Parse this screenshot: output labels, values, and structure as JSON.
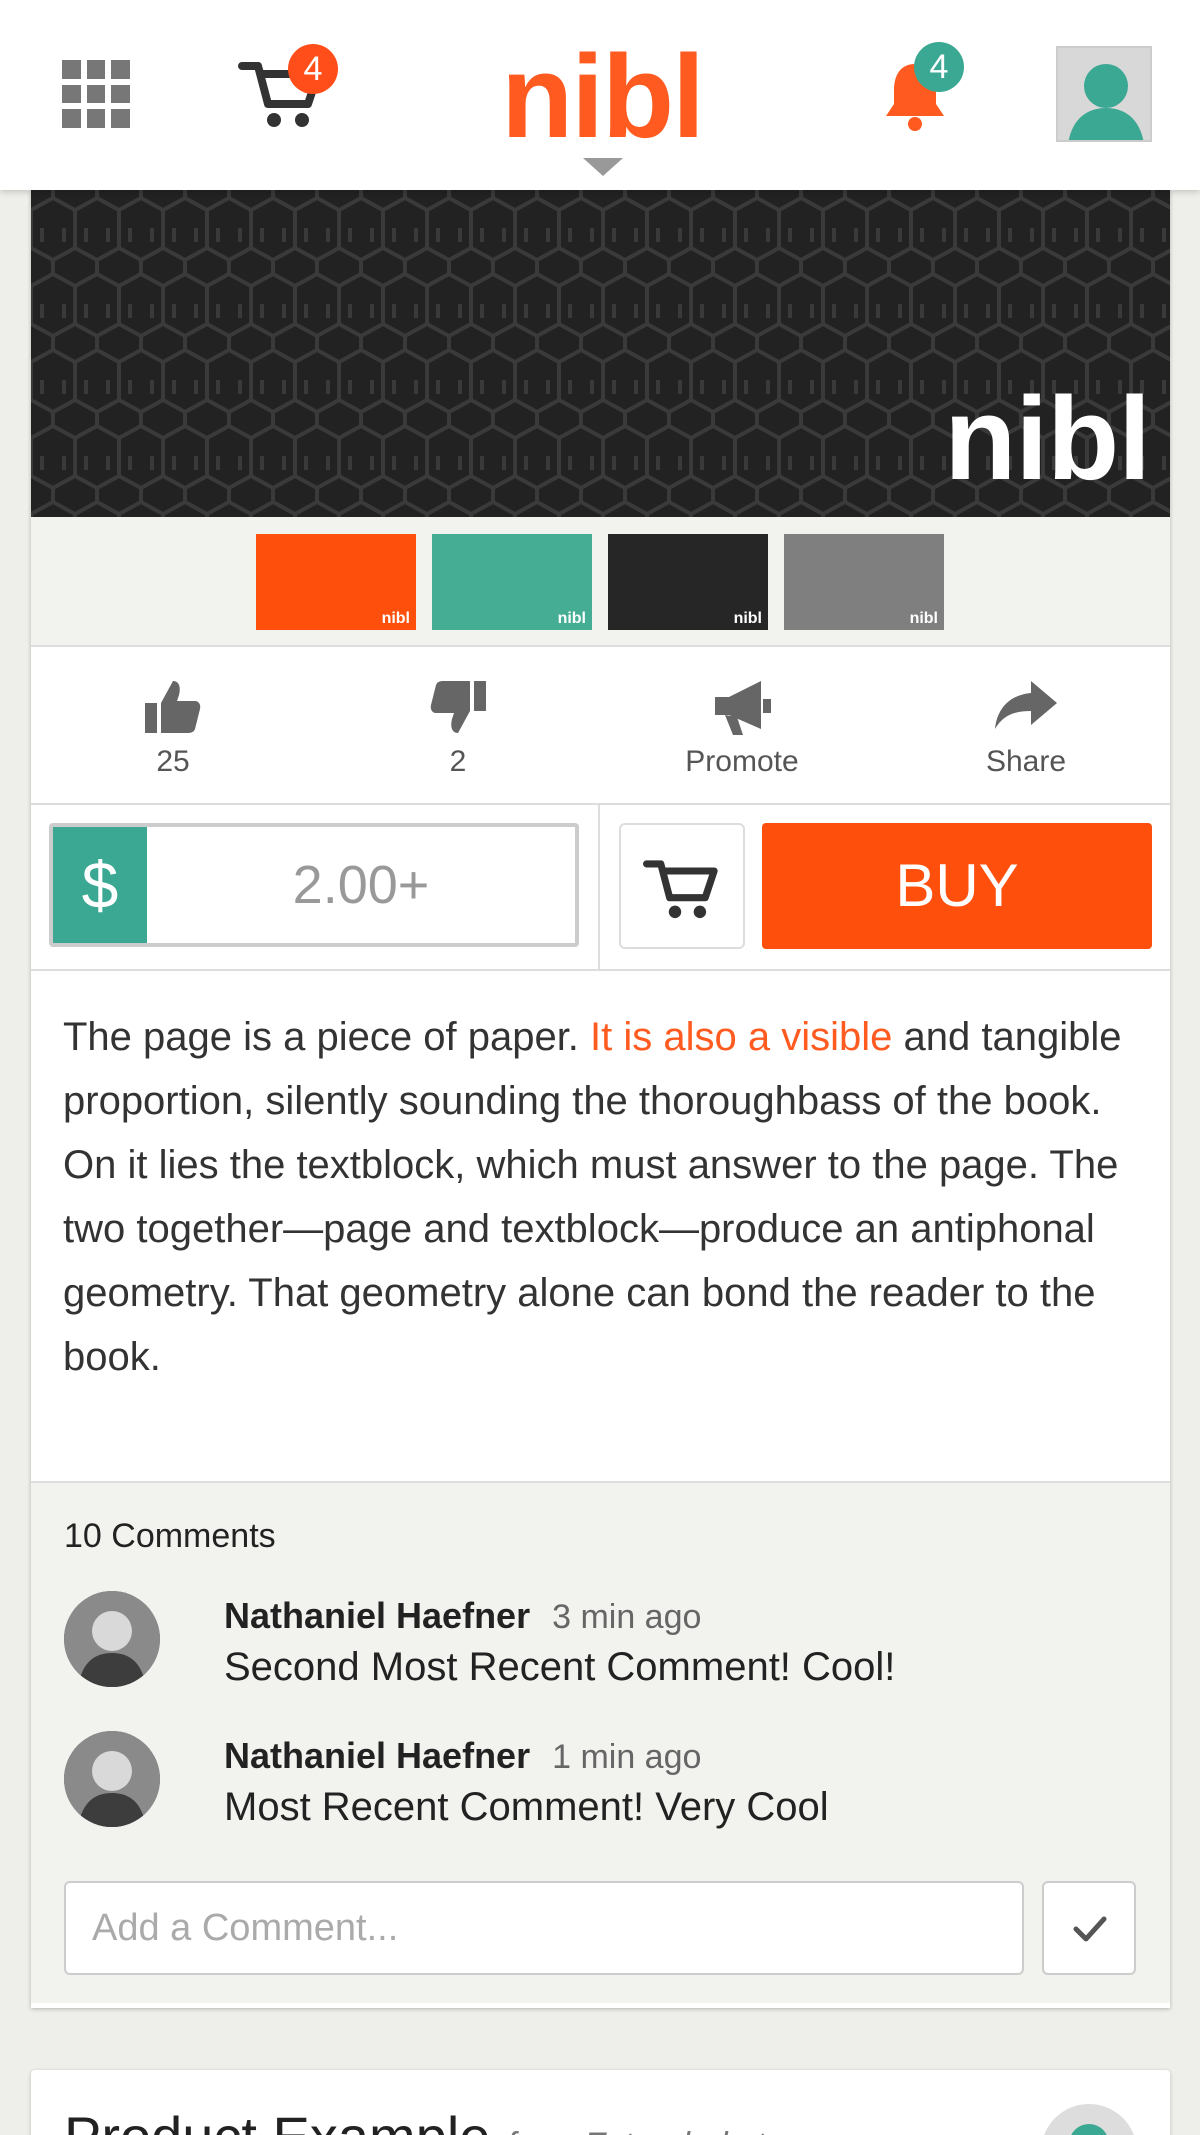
{
  "header": {
    "logo": "nibl",
    "cart_count": "4",
    "notification_count": "4",
    "colors": {
      "brand": "#ff5a1f",
      "teal": "#3aa893"
    }
  },
  "product": {
    "banner_logo": "nibl",
    "swatches": [
      {
        "color": "#ff4f0d",
        "label": "nibl"
      },
      {
        "color": "#45ad93",
        "label": "nibl"
      },
      {
        "color": "#262626",
        "label": "nibl"
      },
      {
        "color": "#7f7f7f",
        "label": "nibl"
      }
    ],
    "actions": {
      "likes": "25",
      "dislikes": "2",
      "promote": "Promote",
      "share": "Share"
    },
    "price": {
      "currency_symbol": "$",
      "value": "2.00+"
    },
    "buy_label": "BUY",
    "description": {
      "before": "The page is a piece of paper. ",
      "highlight": "It is also a visible",
      "after": " and tangible proportion, silently sounding the thoroughbass of the book. On it lies the textblock, which must answer to the page. The two together—page and textblock—produce an antiphonal geometry. That geometry alone can bond the reader to the book."
    }
  },
  "comments": {
    "count_label": "10 Comments",
    "items": [
      {
        "author": "Nathaniel Haefner",
        "time": "3 min ago",
        "text": "Second Most Recent Comment! Cool!"
      },
      {
        "author": "Nathaniel Haefner",
        "time": "1 min ago",
        "text": "Most Recent Comment! Very Cool"
      }
    ],
    "input_placeholder": "Add a Comment..."
  },
  "next_card": {
    "title": "Product Example",
    "subtitle": "from Extended at ..."
  }
}
